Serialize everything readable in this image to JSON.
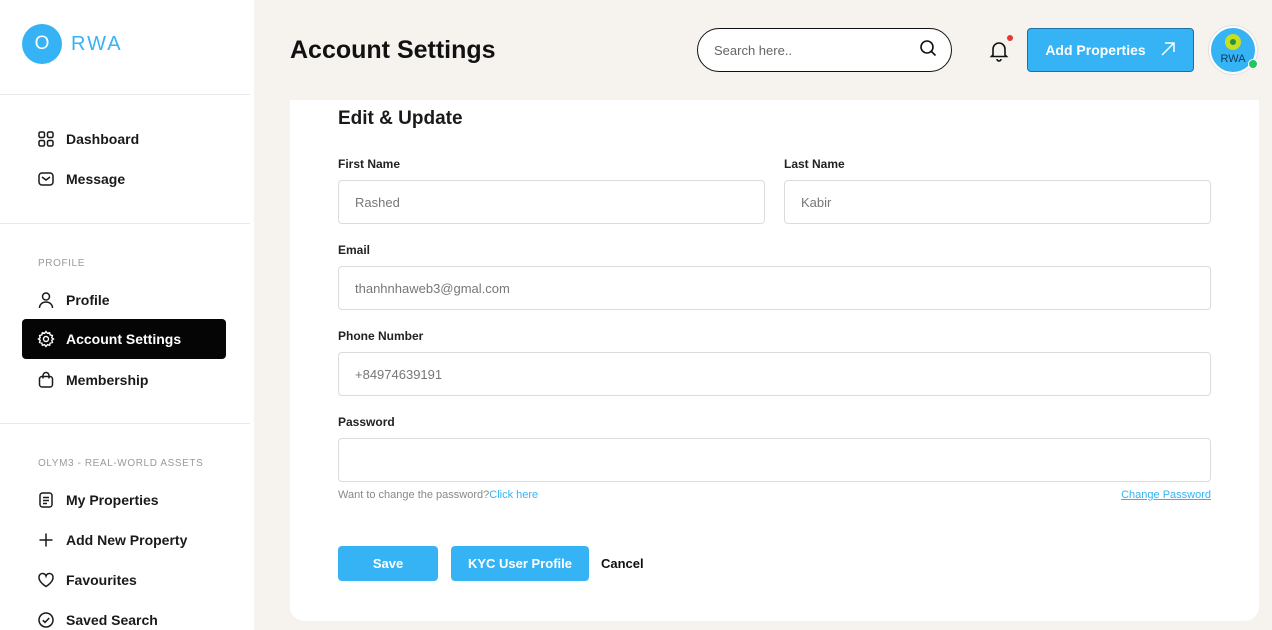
{
  "brand": {
    "logo_letter": "O",
    "logo_text": "RWA"
  },
  "sidebar": {
    "main_items": [
      {
        "label": "Dashboard",
        "icon": "dashboard-icon"
      },
      {
        "label": "Message",
        "icon": "mail-icon"
      }
    ],
    "profile_section": "PROFILE",
    "profile_items": [
      {
        "label": "Profile",
        "icon": "user-icon"
      },
      {
        "label": "Account Settings",
        "icon": "gear-icon",
        "active": true
      },
      {
        "label": "Membership",
        "icon": "bag-icon"
      }
    ],
    "assets_section": "OLYM3 - REAL-WORLD ASSETS",
    "assets_items": [
      {
        "label": "My Properties",
        "icon": "document-icon"
      },
      {
        "label": "Add New Property",
        "icon": "plus-icon"
      },
      {
        "label": "Favourites",
        "icon": "heart-icon"
      },
      {
        "label": "Saved Search",
        "icon": "check-circle-icon"
      }
    ]
  },
  "header": {
    "title": "Account Settings",
    "search_placeholder": "Search here..",
    "add_button": "Add Properties",
    "avatar_text": "RWA"
  },
  "form": {
    "title": "Edit & Update",
    "first_name_label": "First Name",
    "first_name_value": "Rashed",
    "last_name_label": "Last Name",
    "last_name_value": "Kabir",
    "email_label": "Email",
    "email_value": "thanhnhaweb3@gmal.com",
    "phone_label": "Phone Number",
    "phone_value": "+84974639191",
    "password_label": "Password",
    "password_value": "",
    "hint_text": "Want to change the password?",
    "hint_link": "Click here",
    "change_password": "Change Password",
    "save": "Save",
    "kyc": "KYC User Profile",
    "cancel": "Cancel"
  },
  "colors": {
    "accent": "#35b3f5",
    "active_nav": "#050505",
    "background": "#f6f2ee"
  }
}
